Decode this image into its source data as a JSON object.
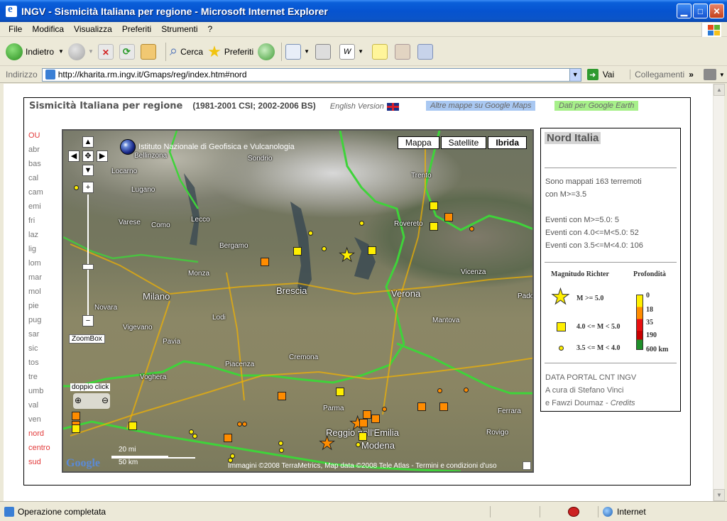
{
  "window": {
    "title": "INGV - Sismicità Italiana per regione - Microsoft Internet Explorer"
  },
  "menu": [
    "File",
    "Modifica",
    "Visualizza",
    "Preferiti",
    "Strumenti",
    "?"
  ],
  "toolbar": {
    "back_label": "Indietro",
    "search_label": "Cerca",
    "favorites_label": "Preferiti"
  },
  "address": {
    "label": "Indirizzo",
    "url": "http://kharita.rm.ingv.it/Gmaps/reg/index.htm#nord",
    "go_label": "Vai",
    "links_label": "Collegamenti"
  },
  "page": {
    "title": "Sismicità Italiana per regione",
    "period": "(1981-2001 CSI; 2002-2006 BS)",
    "english": "English Version",
    "link_google_maps": "Altre mappe su Google Maps",
    "link_google_earth": "Dati per Google Earth",
    "regions": [
      {
        "label": "OU",
        "active": true
      },
      {
        "label": "abr",
        "active": false
      },
      {
        "label": "bas",
        "active": false
      },
      {
        "label": "cal",
        "active": false
      },
      {
        "label": "cam",
        "active": false
      },
      {
        "label": "emi",
        "active": false
      },
      {
        "label": "fri",
        "active": false
      },
      {
        "label": "laz",
        "active": false
      },
      {
        "label": "lig",
        "active": false
      },
      {
        "label": "lom",
        "active": false
      },
      {
        "label": "mar",
        "active": false
      },
      {
        "label": "mol",
        "active": false
      },
      {
        "label": "pie",
        "active": false
      },
      {
        "label": "pug",
        "active": false
      },
      {
        "label": "sar",
        "active": false
      },
      {
        "label": "sic",
        "active": false
      },
      {
        "label": "tos",
        "active": false
      },
      {
        "label": "tre",
        "active": false
      },
      {
        "label": "umb",
        "active": false
      },
      {
        "label": "val",
        "active": false
      },
      {
        "label": "ven",
        "active": false
      },
      {
        "label": "nord",
        "active": true
      },
      {
        "label": "centro",
        "active": true
      },
      {
        "label": "sud",
        "active": true
      }
    ]
  },
  "map": {
    "types": [
      "Mappa",
      "Satellite",
      "Ibrida"
    ],
    "selected_type": "Ibrida",
    "institute": "Istituto Nazionale di Geofisica e Vulcanologia",
    "zoombox_label": "ZoomBox",
    "doubleclick_label": "doppio click",
    "scale_mi": "20 mi",
    "scale_km": "50 km",
    "copyright": "Immagini ©2008 TerraMetrics, Map data ©2008 Tele Atlas - Termini e condizioni d'uso",
    "google_logo": "Google",
    "cities": [
      {
        "name": "Bellinzona"
      },
      {
        "name": "Sondrio"
      },
      {
        "name": "Locarno"
      },
      {
        "name": "Lugano"
      },
      {
        "name": "Varese"
      },
      {
        "name": "Como"
      },
      {
        "name": "Lecco"
      },
      {
        "name": "Bergamo"
      },
      {
        "name": "Monza"
      },
      {
        "name": "Milano"
      },
      {
        "name": "Brescia"
      },
      {
        "name": "Verona"
      },
      {
        "name": "Trento"
      },
      {
        "name": "Rovereto"
      },
      {
        "name": "Vicenza"
      },
      {
        "name": "Padova"
      },
      {
        "name": "Cremona"
      },
      {
        "name": "Piacenza"
      },
      {
        "name": "Parma"
      },
      {
        "name": "Modena"
      },
      {
        "name": "Reggio nell'Emilia"
      },
      {
        "name": "Mantova"
      },
      {
        "name": "Ferrara"
      },
      {
        "name": "Rovigo"
      },
      {
        "name": "Lodi"
      },
      {
        "name": "Pavia"
      },
      {
        "name": "Vigevano"
      },
      {
        "name": "Voghera"
      },
      {
        "name": "Novara"
      }
    ]
  },
  "sidebar": {
    "region_name": "Nord Italia",
    "summary_line1": "Sono mappati 163 terremoti",
    "summary_line2": "con M>=3.5",
    "event_m5": "Eventi con M>=5.0: 5",
    "event_m4": "Eventi con 4.0<=M<5.0: 52",
    "event_m35": "Eventi con 3.5<=M<4.0: 106",
    "legend_magnitude": "Magnitudo Richter",
    "legend_depth": "Profondità",
    "legend_m5": "M >= 5.0",
    "legend_m4": "4.0 <= M < 5.0",
    "legend_m35": "3.5 <= M < 4.0",
    "depth_ticks": [
      "0",
      "18",
      "35",
      "190",
      "600 km"
    ],
    "depth_colors": [
      "#ffef00",
      "#ff8c00",
      "#e81010",
      "#c80000",
      "#1f8f2a"
    ],
    "footer_links": "DATA PORTAL  CNT  INGV",
    "credits_line1": "A cura di Stefano Vinci",
    "credits_line2": "e Fawzi Doumaz - ",
    "credits_link": "Credits"
  },
  "status": {
    "text": "Operazione completata",
    "zone": "Internet"
  }
}
